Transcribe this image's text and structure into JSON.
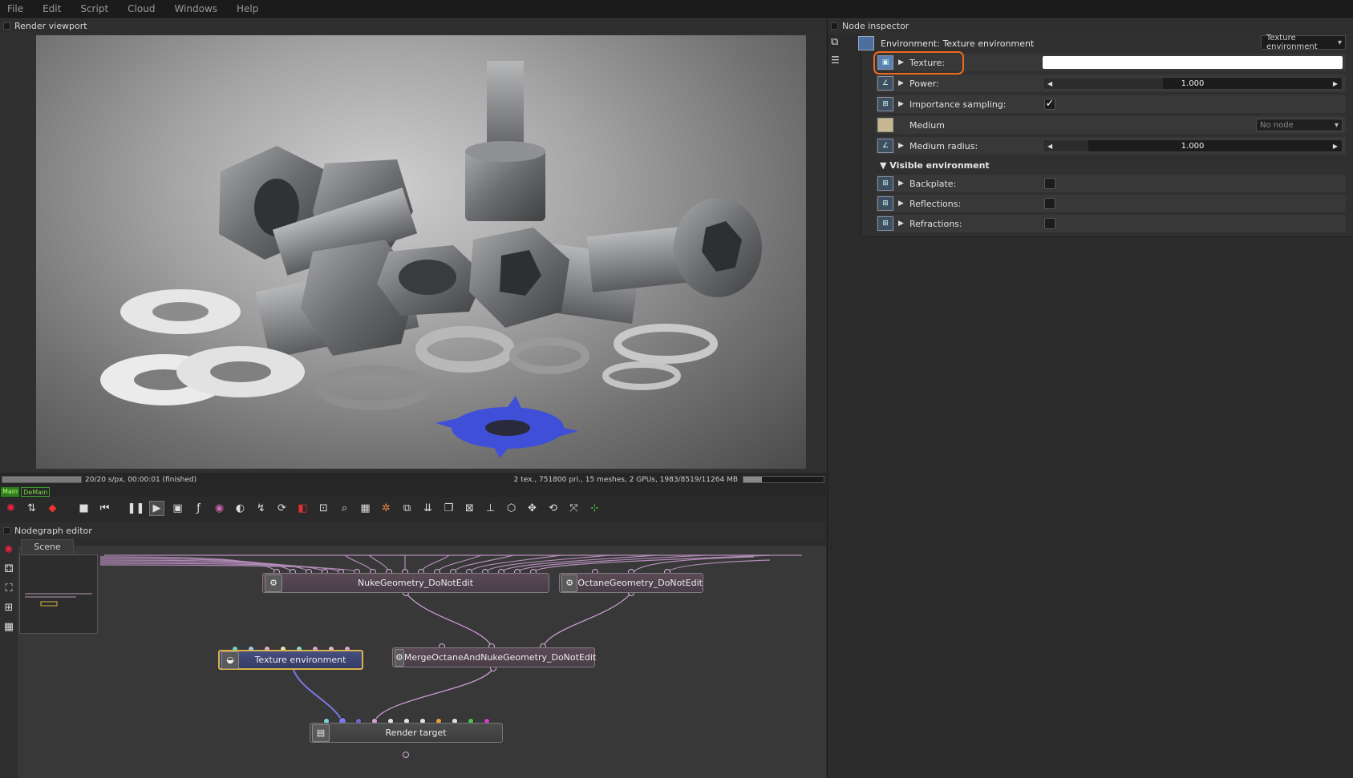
{
  "menu": [
    "File",
    "Edit",
    "Script",
    "Cloud",
    "Windows",
    "Help"
  ],
  "viewport": {
    "title": "Render viewport",
    "progress_fraction": 1.0,
    "samples_text": "20/20 s/px, 00:00:01 (finished)",
    "stats_text": "2 tex., 751800 pri., 15 meshes, 2 GPUs, 1983/8519/11264 MB",
    "memory_fraction": 0.23
  },
  "tags": {
    "main": "Main",
    "demain": "DeMain"
  },
  "nodegraph": {
    "title": "Nodegraph editor",
    "tab": "Scene",
    "nodes": {
      "nuke": "NukeGeometry_DoNotEdit",
      "octane": "OctaneGeometry_DoNotEdit",
      "texenv": "Texture environment",
      "merge": "MergeOctaneAndNukeGeometry_DoNotEdit",
      "render": "Render target"
    }
  },
  "inspector": {
    "title": "Node inspector",
    "node_title": "Environment: Texture environment",
    "type_select": "Texture environment",
    "params": {
      "texture": "Texture:",
      "power": "Power:",
      "power_value": "1.000",
      "importance": "Importance sampling:",
      "importance_checked": "✓",
      "medium": "Medium",
      "medium_value": "No node",
      "medium_radius": "Medium radius:",
      "medium_radius_value": "1.000"
    },
    "section": "▼ Visible environment",
    "visible": {
      "backplate": "Backplate:",
      "reflections": "Reflections:",
      "refractions": "Refractions:"
    }
  },
  "colors": {
    "highlight": "#ef6a1f",
    "accent_blue": "#3f4fd8",
    "tag_green": "#3aa02a"
  }
}
